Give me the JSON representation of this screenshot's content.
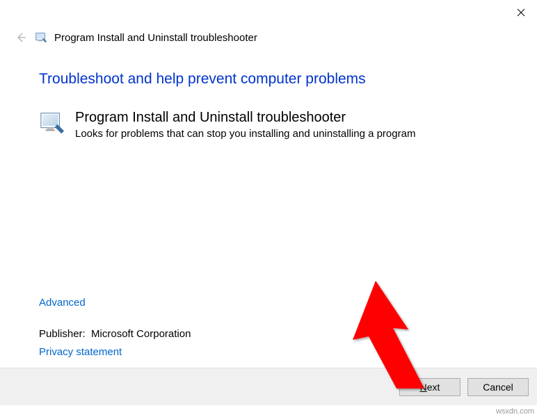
{
  "header": {
    "title": "Program Install and Uninstall troubleshooter"
  },
  "main": {
    "heading": "Troubleshoot and help prevent computer problems",
    "section_title": "Program Install and Uninstall troubleshooter",
    "section_desc": "Looks for problems that can stop you installing and uninstalling a program"
  },
  "links": {
    "advanced": "Advanced",
    "privacy": "Privacy statement"
  },
  "publisher": {
    "label": "Publisher:",
    "value": "Microsoft Corporation"
  },
  "buttons": {
    "next_prefix": "N",
    "next_rest": "ext",
    "cancel": "Cancel"
  },
  "watermark": "wsxdn.com"
}
